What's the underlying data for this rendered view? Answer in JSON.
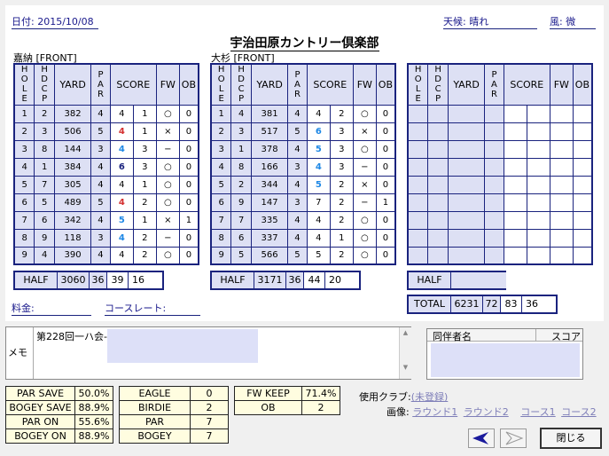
{
  "header": {
    "date": "日付: 2015/10/08",
    "weather": "天候: 晴れ",
    "wind": "風: 微",
    "club_name": "宇治田原カントリー倶楽部"
  },
  "sections": {
    "left": "嘉納 [FRONT]",
    "middle": "大杉 [FRONT]"
  },
  "columns": {
    "hole": "HOLE",
    "hdcp": "HDCP",
    "yard": "YARD",
    "par": "PAR",
    "score": "SCORE",
    "fw": "FW",
    "ob": "OB"
  },
  "front_rows": [
    {
      "hole": "1",
      "hdcp": "2",
      "yard": "382",
      "par": "4",
      "strokes": "4",
      "putts": "1",
      "fw": "○",
      "ob": "0",
      "color": "#000000"
    },
    {
      "hole": "2",
      "hdcp": "3",
      "yard": "506",
      "par": "5",
      "strokes": "4",
      "putts": "1",
      "fw": "×",
      "ob": "0",
      "color": "#d32f2f"
    },
    {
      "hole": "3",
      "hdcp": "8",
      "yard": "144",
      "par": "3",
      "strokes": "4",
      "putts": "3",
      "fw": "−",
      "ob": "0",
      "color": "#1e88e5"
    },
    {
      "hole": "4",
      "hdcp": "1",
      "yard": "384",
      "par": "4",
      "strokes": "6",
      "putts": "3",
      "fw": "○",
      "ob": "0",
      "color": "#1a237e"
    },
    {
      "hole": "5",
      "hdcp": "7",
      "yard": "305",
      "par": "4",
      "strokes": "4",
      "putts": "1",
      "fw": "○",
      "ob": "0",
      "color": "#000000"
    },
    {
      "hole": "6",
      "hdcp": "5",
      "yard": "489",
      "par": "5",
      "strokes": "4",
      "putts": "2",
      "fw": "○",
      "ob": "0",
      "color": "#d32f2f"
    },
    {
      "hole": "7",
      "hdcp": "6",
      "yard": "342",
      "par": "4",
      "strokes": "5",
      "putts": "1",
      "fw": "×",
      "ob": "1",
      "color": "#1e88e5"
    },
    {
      "hole": "8",
      "hdcp": "9",
      "yard": "118",
      "par": "3",
      "strokes": "4",
      "putts": "2",
      "fw": "−",
      "ob": "0",
      "color": "#1e88e5"
    },
    {
      "hole": "9",
      "hdcp": "4",
      "yard": "390",
      "par": "4",
      "strokes": "4",
      "putts": "2",
      "fw": "○",
      "ob": "0",
      "color": "#000000"
    }
  ],
  "front_half": {
    "label": "HALF",
    "yard": "3060",
    "par": "36",
    "strokes": "39",
    "putts": "16"
  },
  "back_rows": [
    {
      "hole": "1",
      "hdcp": "4",
      "yard": "381",
      "par": "4",
      "strokes": "4",
      "putts": "2",
      "fw": "○",
      "ob": "0",
      "color": "#000000"
    },
    {
      "hole": "2",
      "hdcp": "3",
      "yard": "517",
      "par": "5",
      "strokes": "6",
      "putts": "3",
      "fw": "×",
      "ob": "0",
      "color": "#1e88e5"
    },
    {
      "hole": "3",
      "hdcp": "1",
      "yard": "378",
      "par": "4",
      "strokes": "5",
      "putts": "3",
      "fw": "○",
      "ob": "0",
      "color": "#1e88e5"
    },
    {
      "hole": "4",
      "hdcp": "8",
      "yard": "166",
      "par": "3",
      "strokes": "4",
      "putts": "3",
      "fw": "−",
      "ob": "0",
      "color": "#1e88e5"
    },
    {
      "hole": "5",
      "hdcp": "2",
      "yard": "344",
      "par": "4",
      "strokes": "5",
      "putts": "2",
      "fw": "×",
      "ob": "0",
      "color": "#1e88e5"
    },
    {
      "hole": "6",
      "hdcp": "9",
      "yard": "147",
      "par": "3",
      "strokes": "7",
      "putts": "2",
      "fw": "−",
      "ob": "1",
      "color": "#000000"
    },
    {
      "hole": "7",
      "hdcp": "7",
      "yard": "335",
      "par": "4",
      "strokes": "4",
      "putts": "2",
      "fw": "○",
      "ob": "0",
      "color": "#000000"
    },
    {
      "hole": "8",
      "hdcp": "6",
      "yard": "337",
      "par": "4",
      "strokes": "4",
      "putts": "1",
      "fw": "○",
      "ob": "0",
      "color": "#000000"
    },
    {
      "hole": "9",
      "hdcp": "5",
      "yard": "566",
      "par": "5",
      "strokes": "5",
      "putts": "2",
      "fw": "○",
      "ob": "0",
      "color": "#000000"
    }
  ],
  "back_half": {
    "label": "HALF",
    "yard": "3171",
    "par": "36",
    "strokes": "44",
    "putts": "20"
  },
  "third_half": {
    "label": "HALF"
  },
  "total": {
    "label": "TOTAL",
    "yard": "6231",
    "par": "72",
    "strokes": "83",
    "putts": "36"
  },
  "fee": {
    "label": "料金:"
  },
  "course_rate": {
    "label": "コースレート:"
  },
  "memo": {
    "label": "メモ",
    "text": "第228回一ハ会-"
  },
  "companions": {
    "name_header": "同伴者名",
    "score_header": "スコア"
  },
  "stats1": [
    {
      "label": "PAR SAVE",
      "value": "50.0%"
    },
    {
      "label": "BOGEY SAVE",
      "value": "88.9%"
    },
    {
      "label": "PAR ON",
      "value": "55.6%"
    },
    {
      "label": "BOGEY ON",
      "value": "88.9%"
    }
  ],
  "stats2": [
    {
      "label": "EAGLE",
      "value": "0"
    },
    {
      "label": "BIRDIE",
      "value": "2"
    },
    {
      "label": "PAR",
      "value": "7"
    },
    {
      "label": "BOGEY",
      "value": "7"
    }
  ],
  "stats3": [
    {
      "label": "FW KEEP",
      "value": "71.4%"
    },
    {
      "label": "OB",
      "value": "2"
    }
  ],
  "clubs": {
    "label": "使用クラブ:",
    "value": "(未登録)"
  },
  "images": {
    "label": "画像:",
    "links": [
      "ラウンド1",
      "ラウンド2",
      "コース1",
      "コース2"
    ]
  },
  "nav": {
    "prev_icon": "left-arrow-icon",
    "next_icon": "right-arrow-icon",
    "close_label": "閉じる"
  }
}
